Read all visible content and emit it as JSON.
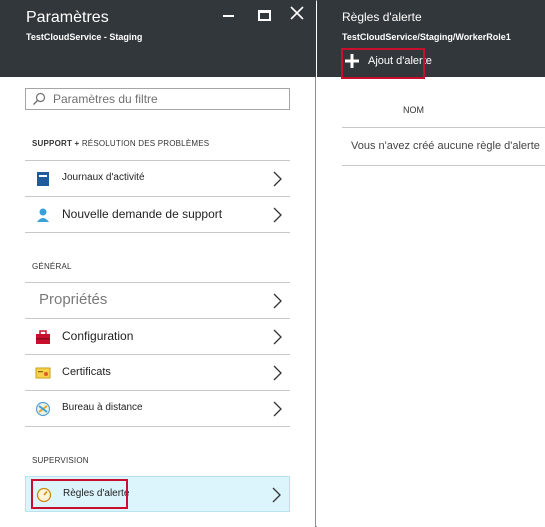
{
  "settings_blade": {
    "title": "Paramètres",
    "subtitle": "TestCloudService - Staging",
    "filter_placeholder": "Paramètres du filtre",
    "sections": {
      "support_bold": "SUPPORT +",
      "support_rest": "RÉSOLUTION DES PROBLÈMES",
      "general": "GÉNÉRAL",
      "monitoring": "SUPERVISION"
    },
    "items": {
      "activity_logs": "Journaux d'activité",
      "new_support_request": "Nouvelle demande de support",
      "properties": "Propriétés",
      "configuration": "Configuration",
      "certificates": "Certificats",
      "remote_desktop": "Bureau à distance",
      "alert_rules": "Règles d'alerte"
    }
  },
  "alert_blade": {
    "title": "Règles d'alerte",
    "subtitle": "TestCloudService/Staging/WorkerRole1",
    "add_label": "Ajout d'alerte",
    "column_name": "NOM",
    "empty_message": "Vous n'avez créé aucune règle d'alerte"
  },
  "colors": {
    "header_bg": "#32373c",
    "highlight_box": "#c8102e",
    "selected_bg": "#dcf4fb"
  }
}
